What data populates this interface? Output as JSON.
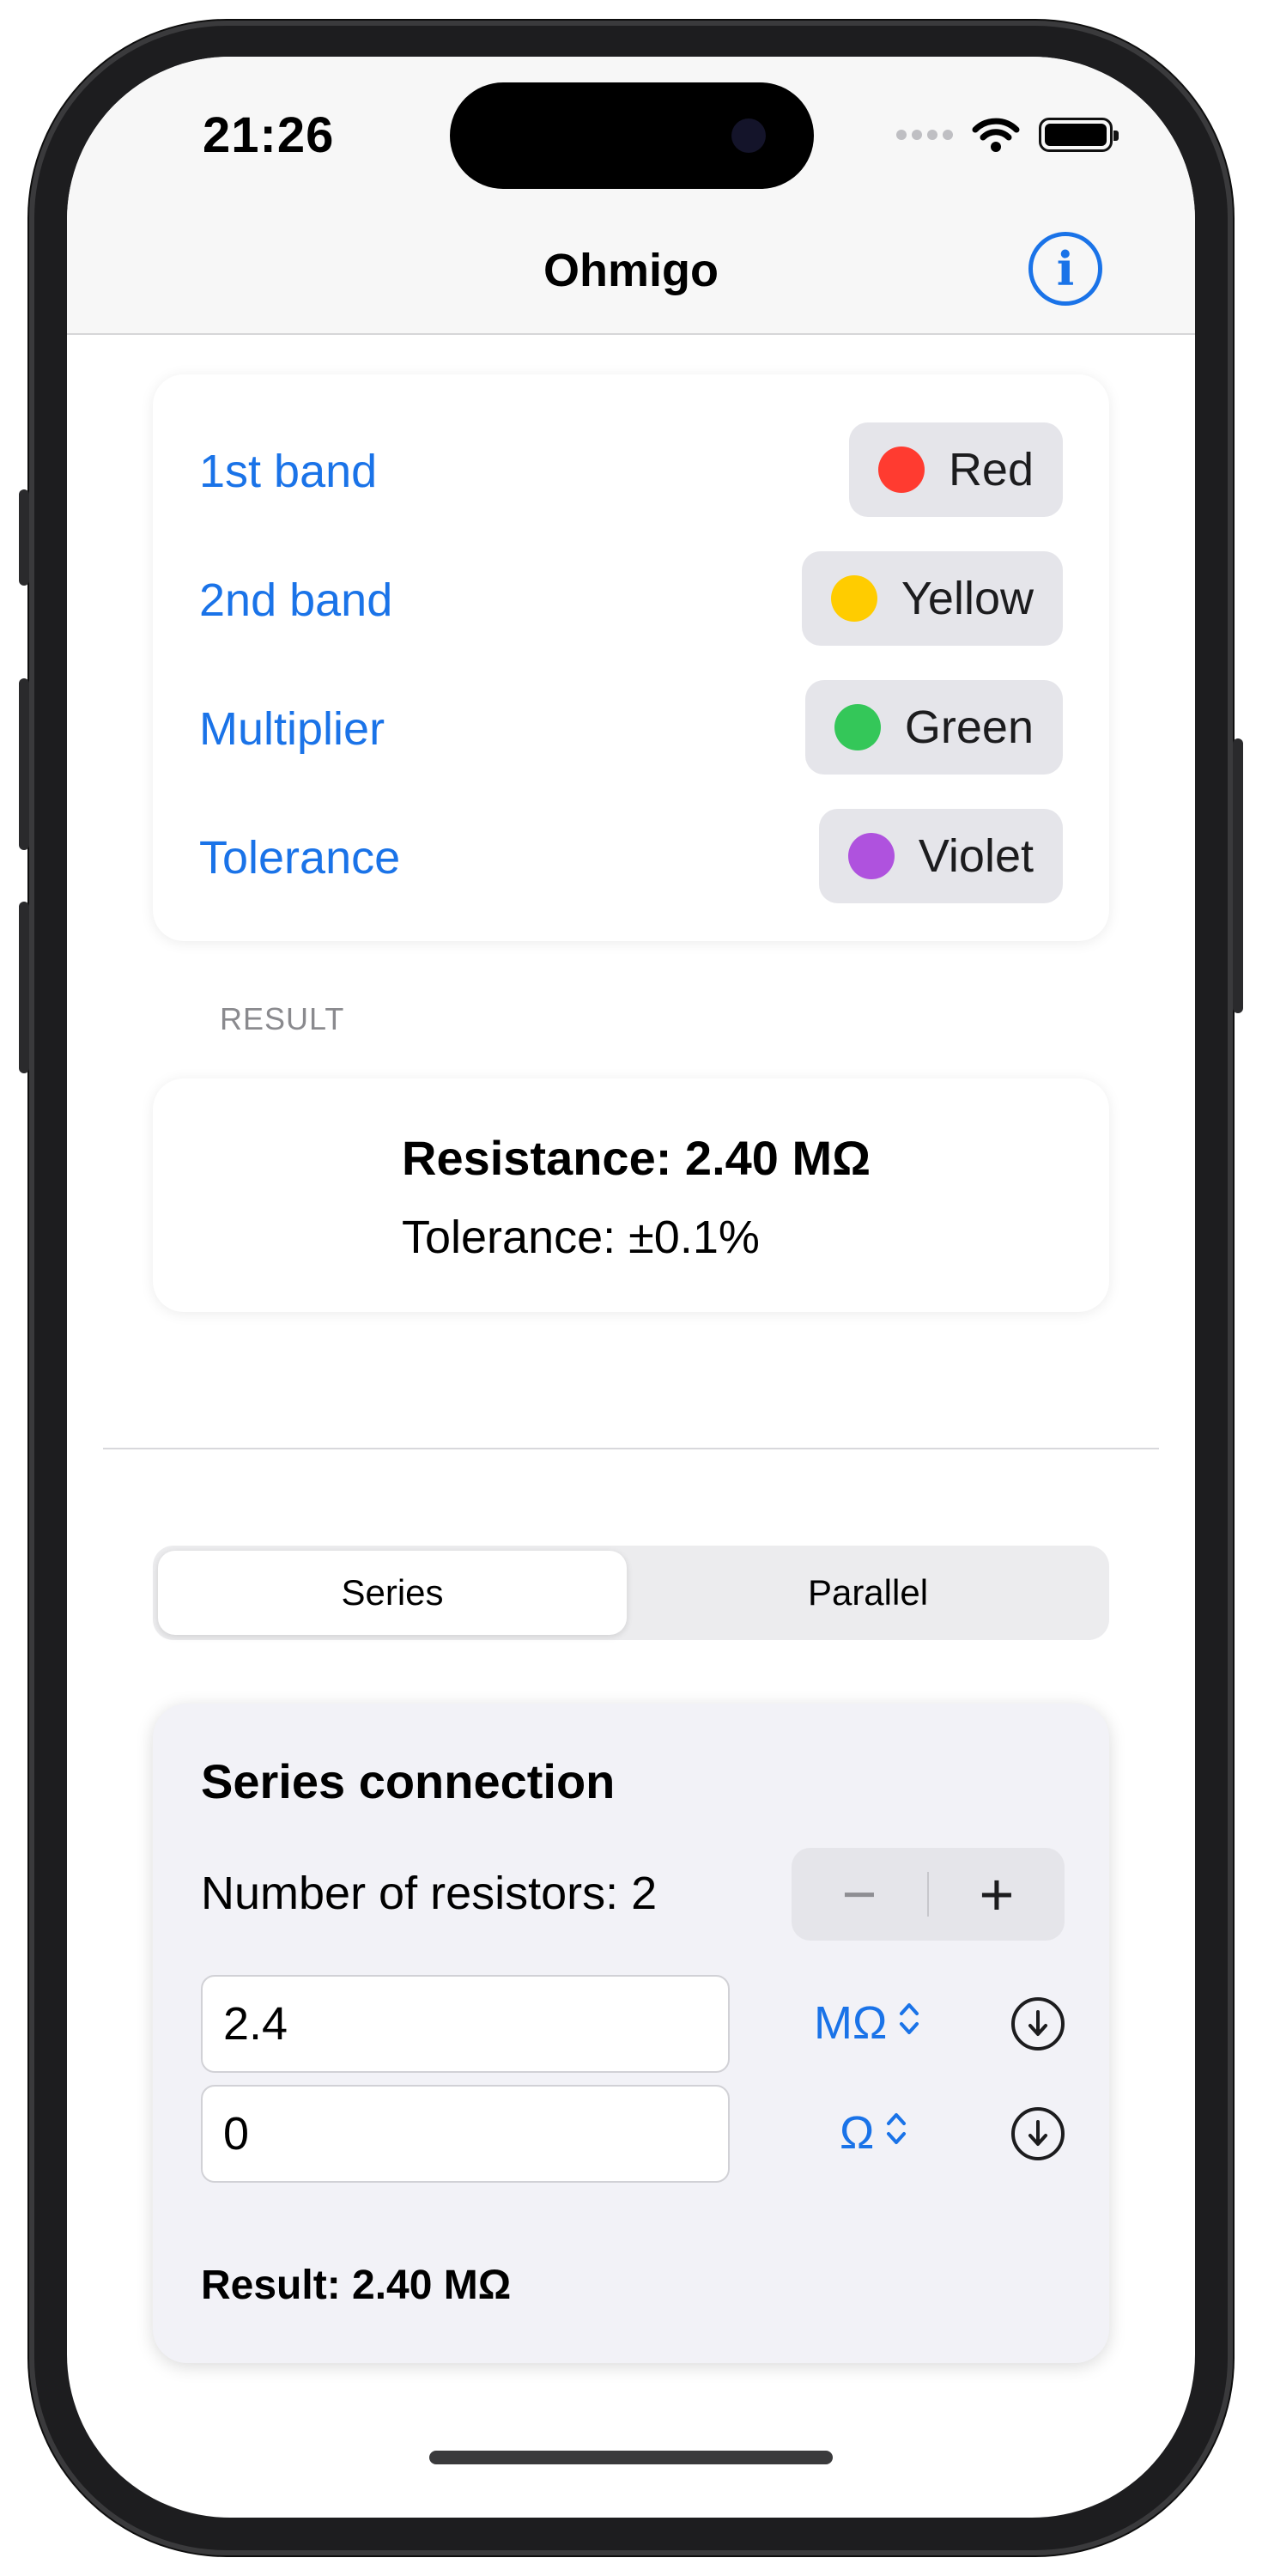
{
  "status": {
    "time": "21:26"
  },
  "nav": {
    "title": "Ohmigo",
    "info_icon": "info-circle-icon"
  },
  "band_colors": {
    "rows": [
      {
        "label": "1st band",
        "color_name": "Red",
        "color": "#ff3b30"
      },
      {
        "label": "2nd band",
        "color_name": "Yellow",
        "color": "#ffcc00"
      },
      {
        "label": "Multiplier",
        "color_name": "Green",
        "color": "#34c759"
      },
      {
        "label": "Tolerance",
        "color_name": "Violet",
        "color": "#af52de"
      }
    ]
  },
  "result": {
    "caption": "RESULT",
    "resistance": "Resistance: 2.40 MΩ",
    "tolerance": "Tolerance: ±0.1%"
  },
  "mode": {
    "segments": [
      "Series",
      "Parallel"
    ],
    "selected": "Series"
  },
  "series": {
    "title": "Series connection",
    "count_label": "Number of resistors: 2",
    "stepper_minus": "−",
    "stepper_plus": "+",
    "resistors": [
      {
        "value": "2.4",
        "unit": "MΩ"
      },
      {
        "value": "0",
        "unit": "Ω"
      }
    ],
    "result": "Result: 2.40 MΩ"
  },
  "colors": {
    "accent": "#1a73e8"
  }
}
